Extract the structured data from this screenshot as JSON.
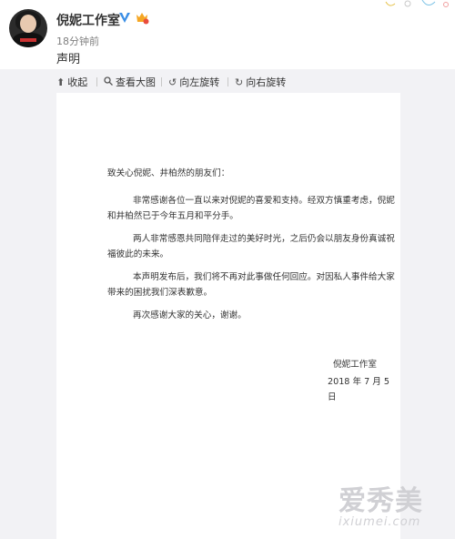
{
  "post": {
    "author": "倪妮工作室",
    "time": "18分钟前",
    "text": "声明",
    "verify_icon": "verified-v-icon",
    "badge_icon": "vip-badge-icon"
  },
  "toolbar": {
    "collapse": "收起",
    "view_large": "查看大图",
    "rotate_left": "向左旋转",
    "rotate_right": "向右旋转"
  },
  "statement": {
    "salutation": "致关心倪妮、井柏然的朋友们：",
    "p1_line1": "非常感谢各位一直以来对倪妮的喜爱和支持。经双方慎重考虑，倪妮",
    "p1_line2": "和井柏然已于今年五月和平分手。",
    "p2_line1": "两人非常感恩共同陪伴走过的美好时光，之后仍会以朋友身份真诚祝",
    "p2_line2": "福彼此的未来。",
    "p3_line1": "本声明发布后，我们将不再对此事做任何回应。对因私人事件给大家",
    "p3_line2": "带来的困扰我们深表歉意。",
    "p4": "再次感谢大家的关心，谢谢。",
    "signature": "倪妮工作室",
    "date": "2018 年 7 月 5 日"
  },
  "watermark": {
    "cn": "爱秀美",
    "en": "ixiumei.com"
  },
  "colors": {
    "verify_blue": "#3a8ee6",
    "badge_orange": "#f5a623",
    "toolbar_bg": "#f2f2f5"
  }
}
